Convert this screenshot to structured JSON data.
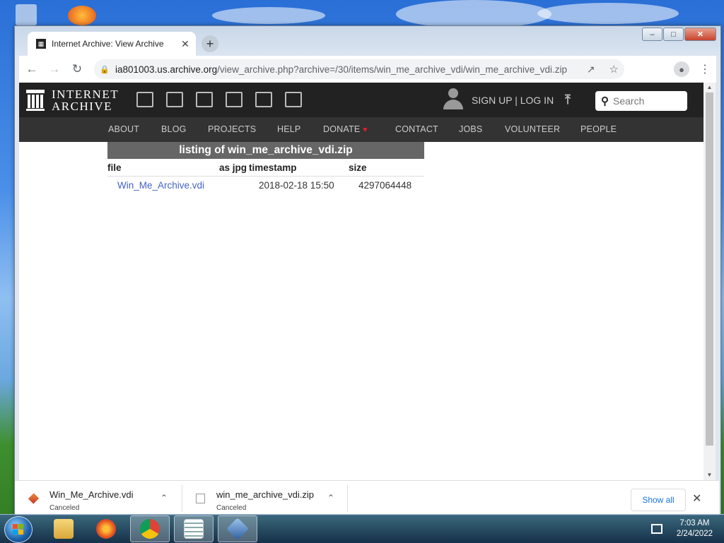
{
  "browser": {
    "tab_title": "Internet Archive: View Archive",
    "url_host": "ia801003.us.archive.org",
    "url_path": "/view_archive.php?archive=/30/items/win_me_archive_vdi/win_me_archive_vdi.zip"
  },
  "ia": {
    "logo_line1": "INTERNET",
    "logo_line2": "ARCHIVE",
    "auth_label": "SIGN UP | LOG IN",
    "search_placeholder": "Search",
    "nav": [
      {
        "label": "ABOUT"
      },
      {
        "label": "BLOG"
      },
      {
        "label": "PROJECTS"
      },
      {
        "label": "HELP"
      },
      {
        "label": "DONATE"
      },
      {
        "label": "CONTACT"
      },
      {
        "label": "JOBS"
      },
      {
        "label": "VOLUNTEER"
      },
      {
        "label": "PEOPLE"
      }
    ]
  },
  "listing": {
    "title": "listing of win_me_archive_vdi.zip",
    "headers": {
      "file": "file",
      "as_jpg": "as jpg",
      "timestamp": "timestamp",
      "size": "size"
    },
    "rows": [
      {
        "file": "Win_Me_Archive.vdi",
        "as_jpg": "",
        "timestamp": "2018-02-18 15:50",
        "size": "4297064448"
      }
    ]
  },
  "downloads": {
    "items": [
      {
        "name": "Win_Me_Archive.vdi",
        "status": "Canceled"
      },
      {
        "name": "win_me_archive_vdi.zip",
        "status": "Canceled"
      }
    ],
    "show_all": "Show all"
  },
  "taskbar": {
    "time": "7:03 AM",
    "date": "2/24/2022"
  },
  "colors": {
    "ia_header": "#222222",
    "ia_nav": "#333333",
    "listing_title_bg": "#666666",
    "link": "#4263c6",
    "donate_heart": "#e02020"
  }
}
